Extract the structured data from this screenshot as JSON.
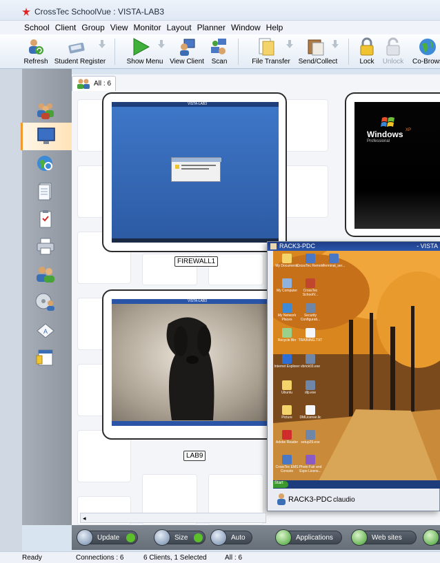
{
  "window": {
    "title": "CrossTec SchoolVue : VISTA-LAB3"
  },
  "menu": [
    "School",
    "Client",
    "Group",
    "View",
    "Monitor",
    "Layout",
    "Planner",
    "Window",
    "Help"
  ],
  "toolbar": {
    "refresh": "Refresh",
    "student_register": "Student Register",
    "show_menu": "Show Menu",
    "view_client": "View Client",
    "scan": "Scan",
    "file_transfer": "File Transfer",
    "send_collect": "Send/Collect",
    "lock": "Lock",
    "unlock": "Unlock",
    "co_browse": "Co-Brows"
  },
  "tab": {
    "label": "All : 6"
  },
  "clients": {
    "firewall": {
      "name": "FIREWALL1",
      "screen_title": "VISTA-LAB3"
    },
    "xp": {
      "screen_brand": "Windows",
      "screen_brand_suffix": "XP",
      "screen_edition": "Professional"
    },
    "lab9": {
      "name": "LAB9",
      "screen_title": "VISTA-LAB3"
    }
  },
  "popup": {
    "title": "RACK3-PDC",
    "title_right": "- VISTA",
    "client_name": "RACK3-PDC",
    "user": "claudio",
    "start_label": "Start",
    "desktop_icons": [
      "My Documents",
      "CrossTec Remote",
      "Terminal_ser...",
      "My Computer",
      "CrossTec SchoolV...",
      "My Network Places",
      "Security Configurati...",
      "Recycle Bin",
      "TRAINING.TXT",
      "Internet Explorer",
      "vbrick03.exe",
      "Ubuntu",
      "dlp.exe",
      "Picture",
      "DMLicense.lic",
      "Adobe Reader",
      "setup29.exe",
      "CrossTec EMS Console",
      "Photo Fair and Expo Licens..."
    ]
  },
  "bottom": {
    "update": "Update",
    "size": "Size",
    "auto": "Auto",
    "applications": "Applications",
    "web_sites": "Web sites"
  },
  "status": {
    "ready": "Ready",
    "connections": "Connections : 6",
    "clients": "6 Clients, 1 Selected",
    "all": "All : 6"
  },
  "colors": {
    "accent": "#f39a2b",
    "titlebar_blue": "#2c56ad",
    "sidebar": "#9aa1aa"
  }
}
